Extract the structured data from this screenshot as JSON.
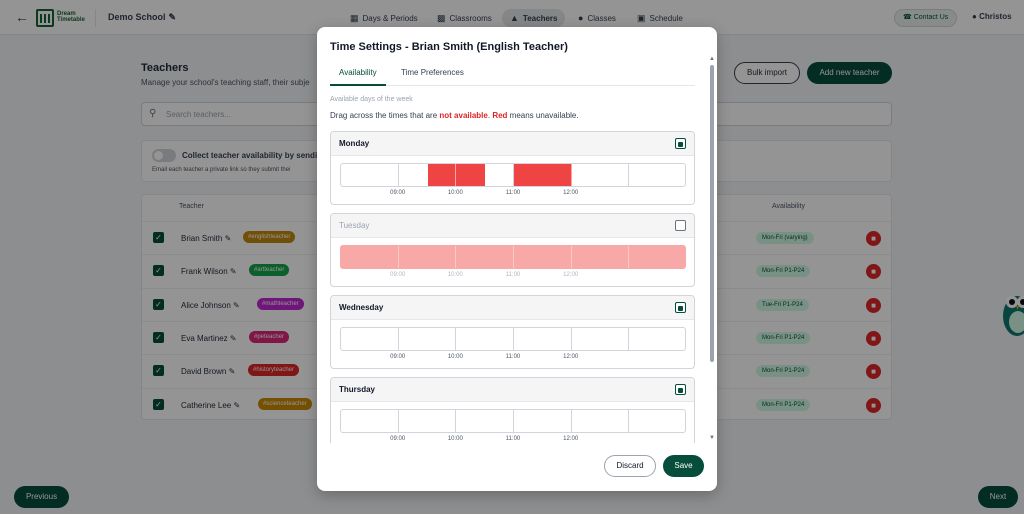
{
  "nav": {
    "logo_line1": "Dream",
    "logo_line2": "Timetable",
    "school": "Demo School",
    "items": [
      {
        "label": "Days & Periods",
        "icon": "calendar-icon"
      },
      {
        "label": "Classrooms",
        "icon": "building-icon"
      },
      {
        "label": "Teachers",
        "icon": "graduation-cap-icon"
      },
      {
        "label": "Classes",
        "icon": "users-icon"
      },
      {
        "label": "Schedule",
        "icon": "table-icon"
      }
    ],
    "contact": "Contact Us",
    "user": "Christos"
  },
  "page": {
    "title": "Teachers",
    "subtitle": "Manage your school's teaching staff, their subje",
    "bulk_import": "Bulk import",
    "add_teacher": "Add new teacher",
    "search_placeholder": "Search teachers...",
    "collect_label": "Collect teacher availability by sendin",
    "collect_sub": "Email each teacher a private link so they submit thei",
    "col_teacher": "Teacher",
    "col_availability": "Availability",
    "teachers": [
      {
        "name": "Brian Smith",
        "tag": "#englishteacher",
        "tag_color": "#c2890f",
        "availability": "Mon-Fri (varying)"
      },
      {
        "name": "Frank Wilson",
        "tag": "#artteacher",
        "tag_color": "#16a34a",
        "availability": "Mon-Fri P1-P24"
      },
      {
        "name": "Alice Johnson",
        "tag": "#mathteacher",
        "tag_color": "#c026d3",
        "availability": "Tue-Fri P1-P24"
      },
      {
        "name": "Eva Martinez",
        "tag": "#peteacher",
        "tag_color": "#db2777",
        "availability": "Mon-Fri P1-P24"
      },
      {
        "name": "David Brown",
        "tag": "#historyteacher",
        "tag_color": "#dc2626",
        "availability": "Mon-Fri P1-P24"
      },
      {
        "name": "Catherine Lee",
        "tag": "#scienceteacher",
        "tag_color": "#ca8a04",
        "availability": "Mon-Fri P1-P24"
      }
    ],
    "previous": "Previous",
    "next": "Next"
  },
  "modal": {
    "title": "Time Settings - Brian Smith (English Teacher)",
    "tabs": [
      "Availability",
      "Time Preferences"
    ],
    "section_label": "Available days of the week",
    "instr_1": "Drag across the times that are ",
    "instr_not_available": "not available",
    "instr_2": ". ",
    "instr_red": "Red",
    "instr_3": " means unavailable.",
    "ticks": [
      "09:00",
      "10:00",
      "11:00",
      "12:00"
    ],
    "days": [
      {
        "name": "Monday",
        "enabled": true,
        "unavailable_slots": [
          3,
          4,
          6,
          7
        ]
      },
      {
        "name": "Tuesday",
        "enabled": false,
        "unavailable_slots": []
      },
      {
        "name": "Wednesday",
        "enabled": true,
        "unavailable_slots": []
      },
      {
        "name": "Thursday",
        "enabled": true,
        "unavailable_slots": []
      }
    ],
    "discard": "Discard",
    "save": "Save"
  }
}
